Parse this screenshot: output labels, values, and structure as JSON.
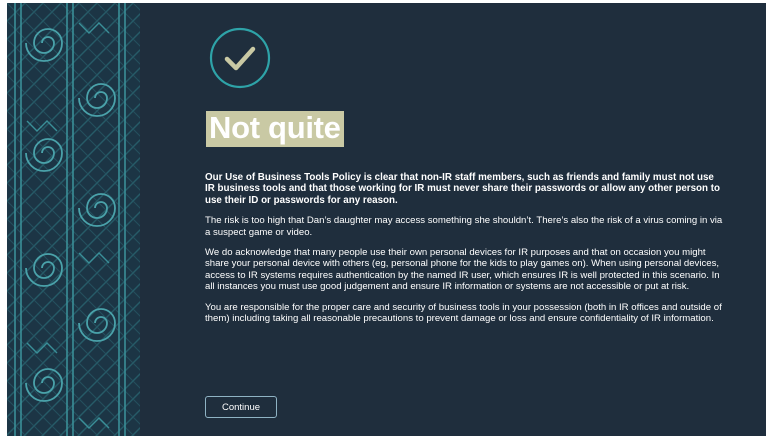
{
  "feedback": {
    "icon": "checkmark-icon",
    "title": "Not quite",
    "paragraphs": [
      "Our Use of Business Tools Policy is clear that non-IR staff members, such as friends and family must not use IR business tools and that those working for IR must never share their passwords or allow any other person to use their ID or passwords for any reason.",
      "The risk is too high that Dan’s daughter may access something she shouldn’t. There’s also the risk of a virus coming in via a suspect game or video.",
      "We do acknowledge that many people use their own personal devices for IR purposes and that on occasion you might share your personal device with others (eg, personal phone for the kids to play games on).  When using personal devices, access to IR systems requires authentication by the named IR user, which ensures IR is well protected in this scenario.  In all instances you must use good judgement and ensure IR information or systems are not accessible or put at risk.",
      "You are responsible for the proper care and security of business tools in your possession (both in IR offices and outside of them) including taking all reasonable precautions to prevent damage or loss and ensure confidentiality of IR information."
    ],
    "continue_label": "Continue"
  },
  "colors": {
    "background": "#1f2e3d",
    "accent_teal": "#2ea3a8",
    "check_color": "#c9c9a4",
    "title_highlight": "#c9c9a4"
  }
}
